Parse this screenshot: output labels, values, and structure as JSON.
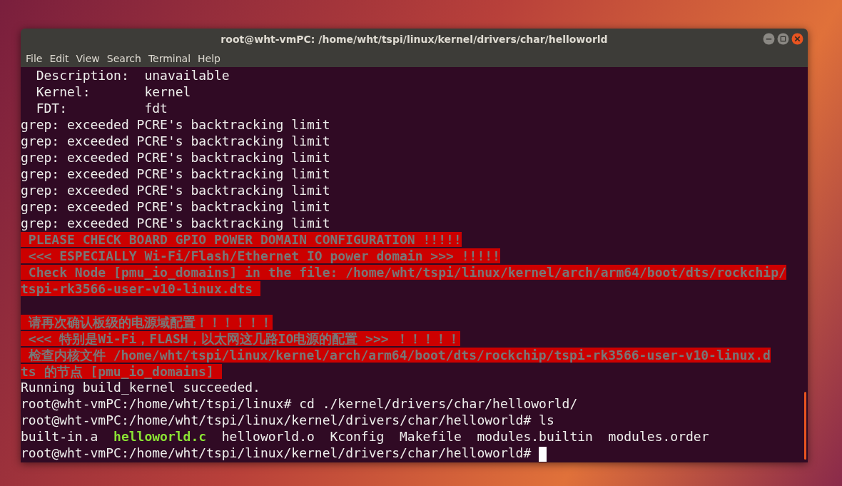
{
  "window": {
    "title": "root@wht-vmPC: /home/wht/tspi/linux/kernel/drivers/char/helloworld"
  },
  "menu": [
    "File",
    "Edit",
    "View",
    "Search",
    "Terminal",
    "Help"
  ],
  "terminal": {
    "lines": [
      {
        "segments": [
          {
            "kind": "plain",
            "text": "  Description:  unavailable"
          }
        ]
      },
      {
        "segments": [
          {
            "kind": "plain",
            "text": "  Kernel:       kernel"
          }
        ]
      },
      {
        "segments": [
          {
            "kind": "plain",
            "text": "  FDT:          fdt"
          }
        ]
      },
      {
        "segments": [
          {
            "kind": "plain",
            "text": "grep: exceeded PCRE's backtracking limit"
          }
        ]
      },
      {
        "segments": [
          {
            "kind": "plain",
            "text": "grep: exceeded PCRE's backtracking limit"
          }
        ]
      },
      {
        "segments": [
          {
            "kind": "plain",
            "text": "grep: exceeded PCRE's backtracking limit"
          }
        ]
      },
      {
        "segments": [
          {
            "kind": "plain",
            "text": "grep: exceeded PCRE's backtracking limit"
          }
        ]
      },
      {
        "segments": [
          {
            "kind": "plain",
            "text": "grep: exceeded PCRE's backtracking limit"
          }
        ]
      },
      {
        "segments": [
          {
            "kind": "plain",
            "text": "grep: exceeded PCRE's backtracking limit"
          }
        ]
      },
      {
        "segments": [
          {
            "kind": "plain",
            "text": "grep: exceeded PCRE's backtracking limit"
          }
        ]
      },
      {
        "segments": [
          {
            "kind": "alert",
            "text": " PLEASE CHECK BOARD GPIO POWER DOMAIN CONFIGURATION !!!!!"
          }
        ]
      },
      {
        "segments": [
          {
            "kind": "alert",
            "text": " <<< ESPECIALLY Wi-Fi/Flash/Ethernet IO power domain >>> !!!!!"
          }
        ]
      },
      {
        "segments": [
          {
            "kind": "alert",
            "text": " Check Node [pmu_io_domains] in the file: /home/wht/tspi/linux/kernel/arch/arm64/boot/dts/rockchip/"
          }
        ]
      },
      {
        "segments": [
          {
            "kind": "alert",
            "text": "tspi-rk3566-user-v10-linux.dts "
          }
        ]
      },
      {
        "gap_before": true,
        "segments": [
          {
            "kind": "alert",
            "text": " 请再次确认板级的电源域配置！！！！！！"
          }
        ]
      },
      {
        "segments": [
          {
            "kind": "alert",
            "text": " <<< 特别是Wi-Fi，FLASH，以太网这几路IO电源的配置 >>> ！！！！！"
          }
        ]
      },
      {
        "segments": [
          {
            "kind": "alert",
            "text": " 检查内核文件 /home/wht/tspi/linux/kernel/arch/arm64/boot/dts/rockchip/tspi-rk3566-user-v10-linux.d"
          }
        ]
      },
      {
        "segments": [
          {
            "kind": "alert",
            "text": "ts 的节点 [pmu_io_domains] "
          }
        ]
      },
      {
        "segments": [
          {
            "kind": "plain",
            "text": "Running build_kernel succeeded."
          }
        ]
      },
      {
        "segments": [
          {
            "kind": "plain",
            "text": "root@wht-vmPC:/home/wht/tspi/linux# cd ./kernel/drivers/char/helloworld/"
          }
        ]
      },
      {
        "segments": [
          {
            "kind": "plain",
            "text": "root@wht-vmPC:/home/wht/tspi/linux/kernel/drivers/char/helloworld# ls"
          }
        ]
      },
      {
        "segments": [
          {
            "kind": "plain",
            "text": "built-in.a  "
          },
          {
            "kind": "executable",
            "text": "helloworld.c"
          },
          {
            "kind": "plain",
            "text": "  helloworld.o  Kconfig  Makefile  modules.builtin  modules.order"
          }
        ]
      },
      {
        "segments": [
          {
            "kind": "plain",
            "text": "root@wht-vmPC:/home/wht/tspi/linux/kernel/drivers/char/helloworld# "
          }
        ],
        "cursor": true
      }
    ]
  }
}
